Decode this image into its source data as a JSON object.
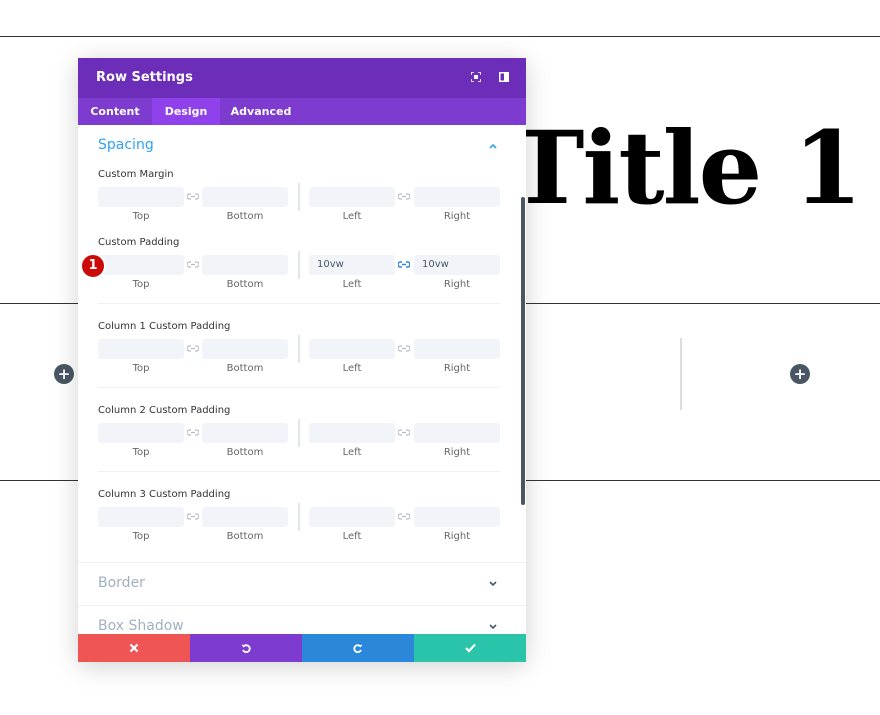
{
  "background": {
    "title": "Title 1",
    "add_buttons": [
      "+",
      "+"
    ]
  },
  "modal": {
    "title": "Row Settings",
    "header_icons": [
      "fullscreen-icon",
      "split-view-icon"
    ],
    "tabs": [
      {
        "label": "Content",
        "active": false
      },
      {
        "label": "Design",
        "active": true
      },
      {
        "label": "Advanced",
        "active": false
      }
    ],
    "spacing": {
      "title": "Spacing",
      "groups": [
        {
          "label": "Custom Margin",
          "top": "",
          "bottom": "",
          "left": "",
          "right": "",
          "lr_linked": false
        },
        {
          "label": "Custom Padding",
          "top": "",
          "bottom": "",
          "left": "10vw",
          "right": "10vw",
          "lr_linked": true
        },
        {
          "label": "Column 1 Custom Padding",
          "top": "",
          "bottom": "",
          "left": "",
          "right": "",
          "lr_linked": false
        },
        {
          "label": "Column 2 Custom Padding",
          "top": "",
          "bottom": "",
          "left": "",
          "right": "",
          "lr_linked": false
        },
        {
          "label": "Column 3 Custom Padding",
          "top": "",
          "bottom": "",
          "left": "",
          "right": "",
          "lr_linked": false
        }
      ],
      "sublabels": {
        "top": "Top",
        "bottom": "Bottom",
        "left": "Left",
        "right": "Right"
      }
    },
    "collapsed_sections": [
      "Border",
      "Box Shadow"
    ],
    "step_badge": "1",
    "footer": {
      "cancel_icon": "close-icon",
      "undo_icon": "undo-icon",
      "redo_icon": "redo-icon",
      "save_icon": "check-icon"
    }
  },
  "colors": {
    "header": "#6c2eb9",
    "tabs": "#7e3bd0",
    "active_tab": "#8f42ec",
    "accent_blue": "#2ea3f2",
    "cancel": "#ef5555",
    "undo": "#7e3bd0",
    "redo": "#2b87da",
    "save": "#29c4a9"
  }
}
